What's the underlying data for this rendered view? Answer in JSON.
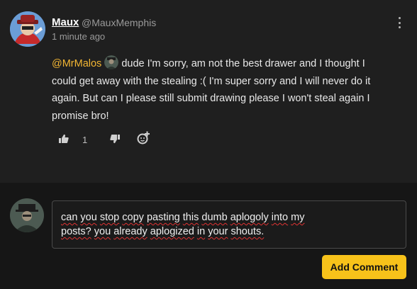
{
  "comment": {
    "username": "Maux",
    "handle": "@MauxMemphis",
    "timestamp": "1 minute ago",
    "mention": "@MrMalos",
    "text": "dude I'm sorry, am not the best drawer and I thought I could get away with the stealing :( I'm super sorry and I will never do it again. But can I please still submit drawing please I won't steal again I promise bro!",
    "like_count": "1",
    "icons": [
      "thumbs-up-icon",
      "thumbs-down-icon",
      "add-emoji-icon",
      "more-options-icon"
    ]
  },
  "reply": {
    "lines": [
      [
        "can",
        "you",
        "stop",
        "copy",
        "pasting",
        "this",
        "dumb",
        "aplogoly",
        "into",
        "my"
      ],
      [
        "posts?",
        "you",
        "already",
        "aplogized",
        "in",
        "your",
        "shouts."
      ]
    ],
    "misspelled_words": [
      "aplogoly",
      "aplogized"
    ],
    "submit_label": "Add Comment"
  },
  "colors": {
    "background": "#1f1f1f",
    "reply_background": "#161616",
    "mention": "#f3b633",
    "button": "#f7c21a",
    "spellcheck": "#e03333"
  }
}
